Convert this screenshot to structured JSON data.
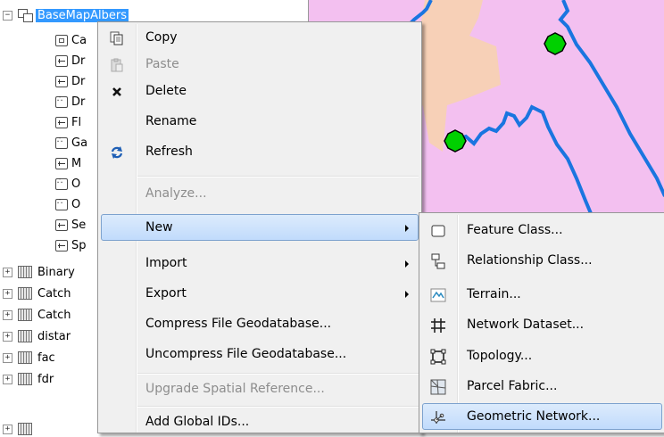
{
  "tree": {
    "root_label": "BaseMapAlbers",
    "children": [
      "Ca",
      "Dr",
      "Dr",
      "Dr",
      "Fl",
      "Ga",
      "M",
      "O",
      "O",
      "Se",
      "Sp"
    ],
    "rasters": [
      "Binary",
      "Catch",
      "Catch",
      "distar",
      "fac",
      "fdr"
    ]
  },
  "context_menu": {
    "copy": "Copy",
    "paste": "Paste",
    "delete": "Delete",
    "rename": "Rename",
    "refresh": "Refresh",
    "analyze": "Analyze...",
    "new": "New",
    "import": "Import",
    "export": "Export",
    "compress": "Compress File Geodatabase...",
    "uncompress": "Uncompress File Geodatabase...",
    "upgrade": "Upgrade Spatial Reference...",
    "add_global_ids": "Add Global IDs..."
  },
  "new_submenu": {
    "feature_class": "Feature Class...",
    "relationship_class": "Relationship Class...",
    "terrain": "Terrain...",
    "network_dataset": "Network Dataset...",
    "topology": "Topology...",
    "parcel_fabric": "Parcel Fabric...",
    "geometric_network": "Geometric Network..."
  },
  "icons": {
    "copy": "copy-icon",
    "paste": "paste-icon",
    "delete": "delete-icon",
    "refresh": "refresh-icon",
    "submenu_arrow": "chevron-right-icon"
  },
  "colors": {
    "selection": "#3399ff",
    "menu_hover": "#c1dbfc",
    "map_fill_pink": "#f3c0f0",
    "map_fill_tan": "#f7d0b7",
    "river": "#1a75e0",
    "gauge_point": "#00d000"
  }
}
